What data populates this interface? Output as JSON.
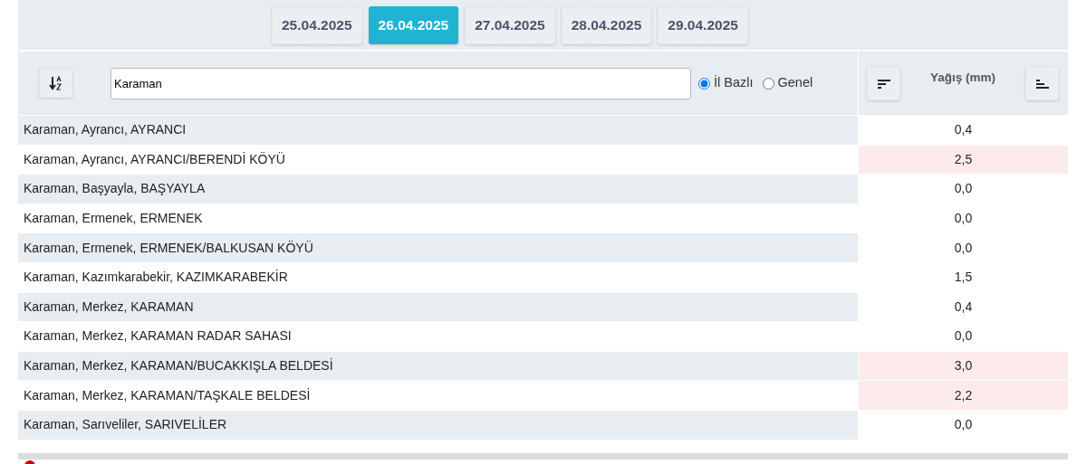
{
  "dates": [
    {
      "label": "25.04.2025",
      "selected": false
    },
    {
      "label": "26.04.2025",
      "selected": true
    },
    {
      "label": "27.04.2025",
      "selected": false
    },
    {
      "label": "28.04.2025",
      "selected": false
    },
    {
      "label": "29.04.2025",
      "selected": false
    }
  ],
  "search": {
    "value": "Karaman"
  },
  "scope_options": [
    {
      "label": "İl Bazlı",
      "selected": true
    },
    {
      "label": "Genel",
      "selected": false
    }
  ],
  "value_column": {
    "title": "Yağış (mm)"
  },
  "rows": [
    {
      "name": "Karaman, Ayrancı, AYRANCI",
      "value": "0,4",
      "highlight": false
    },
    {
      "name": "Karaman, Ayrancı, AYRANCI/BERENDİ KÖYÜ",
      "value": "2,5",
      "highlight": true
    },
    {
      "name": "Karaman, Başyayla, BAŞYAYLA",
      "value": "0,0",
      "highlight": false
    },
    {
      "name": "Karaman, Ermenek, ERMENEK",
      "value": "0,0",
      "highlight": false
    },
    {
      "name": "Karaman, Ermenek, ERMENEK/BALKUSAN KÖYÜ",
      "value": "0,0",
      "highlight": false
    },
    {
      "name": "Karaman, Kazımkarabekir, KAZIMKARABEKİR",
      "value": "1,5",
      "highlight": false
    },
    {
      "name": "Karaman, Merkez, KARAMAN",
      "value": "0,4",
      "highlight": false
    },
    {
      "name": "Karaman, Merkez, KARAMAN RADAR SAHASI",
      "value": "0,0",
      "highlight": false
    },
    {
      "name": "Karaman, Merkez, KARAMAN/BUCAKKIŞLA BELDESİ",
      "value": "3,0",
      "highlight": true
    },
    {
      "name": "Karaman, Merkez, KARAMAN/TAŞKALE BELDESİ",
      "value": "2,2",
      "highlight": true
    },
    {
      "name": "Karaman, Sarıveliler, SARIVELİLER",
      "value": "0,0",
      "highlight": false
    }
  ]
}
